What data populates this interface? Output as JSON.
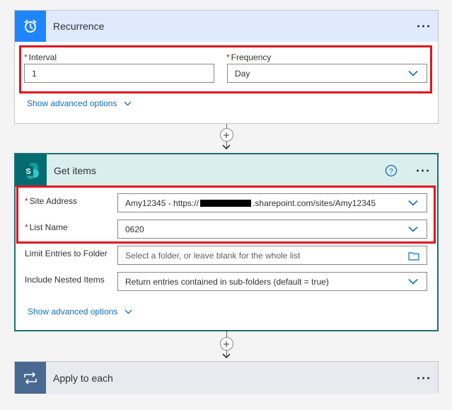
{
  "recurrence": {
    "title": "Recurrence",
    "interval": {
      "label": "Interval",
      "required": "*",
      "value": "1"
    },
    "frequency": {
      "label": "Frequency",
      "required": "*",
      "value": "Day"
    },
    "advanced": "Show advanced options"
  },
  "getitems": {
    "title": "Get items",
    "site_address": {
      "label": "Site Address",
      "required": "*",
      "value_prefix": "Amy12345 - https://",
      "value_suffix": ".sharepoint.com/sites/Amy12345"
    },
    "list_name": {
      "label": "List Name",
      "required": "*",
      "value": "0620"
    },
    "limit_folder": {
      "label": "Limit Entries to Folder",
      "placeholder": "Select a folder, or leave blank for the whole list"
    },
    "nested": {
      "label": "Include Nested Items",
      "value": "Return entries contained in sub-folders (default = true)"
    },
    "advanced": "Show advanced options"
  },
  "apply": {
    "title": "Apply to each"
  },
  "colors": {
    "highlight": "#e3141f",
    "link": "#0f6cbd",
    "recurrence_icon": "#1f85ff",
    "sharepoint_icon": "#036c70",
    "apply_icon": "#486991"
  },
  "icons": {
    "recurrence": "alarm-clock-icon",
    "sharepoint": "sharepoint-icon",
    "apply": "loop-icon",
    "help": "question-circle-icon",
    "folder": "folder-icon"
  }
}
